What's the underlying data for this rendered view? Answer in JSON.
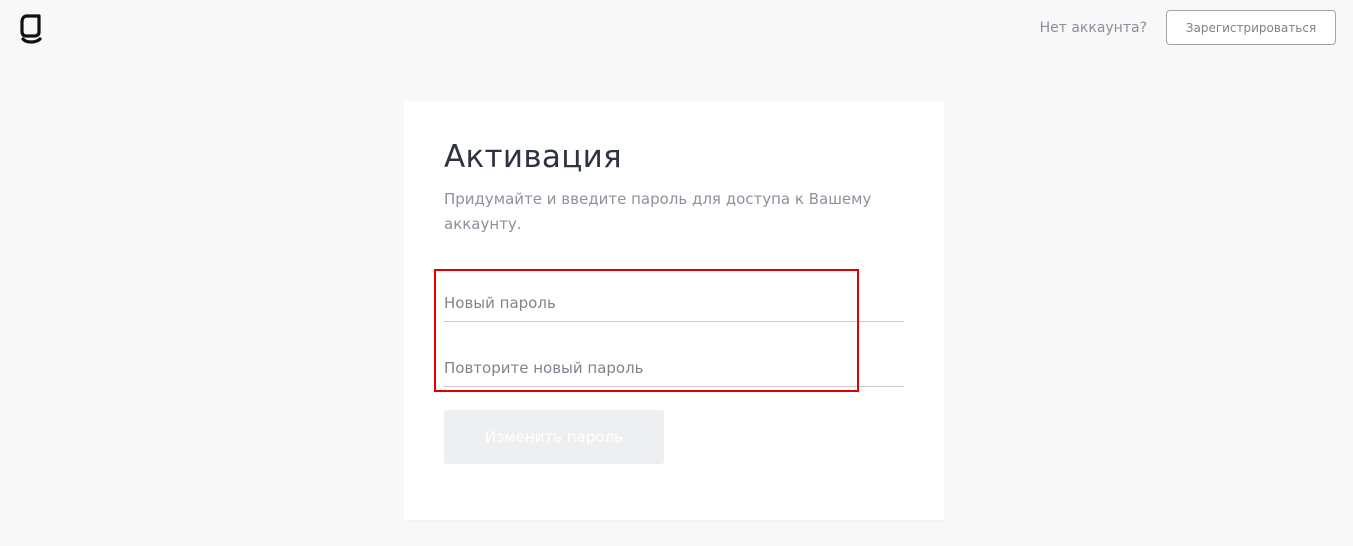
{
  "header": {
    "logo_icon": "g-logo-icon",
    "no_account_text": "Нет аккаунта?",
    "register_label": "Зарегистрироваться"
  },
  "card": {
    "title": "Активация",
    "subtitle": "Придумайте и введите пароль для доступа к Вашему аккаунту.",
    "new_password": {
      "placeholder": "Новый пароль",
      "value": ""
    },
    "repeat_password": {
      "placeholder": "Повторите новый пароль",
      "value": ""
    },
    "submit_label": "Изменить пароль",
    "submit_enabled": false
  },
  "colors": {
    "background": "#f8f8f9",
    "card": "#ffffff",
    "highlight": "#e00000",
    "disabled_button": "#eeeff1"
  }
}
